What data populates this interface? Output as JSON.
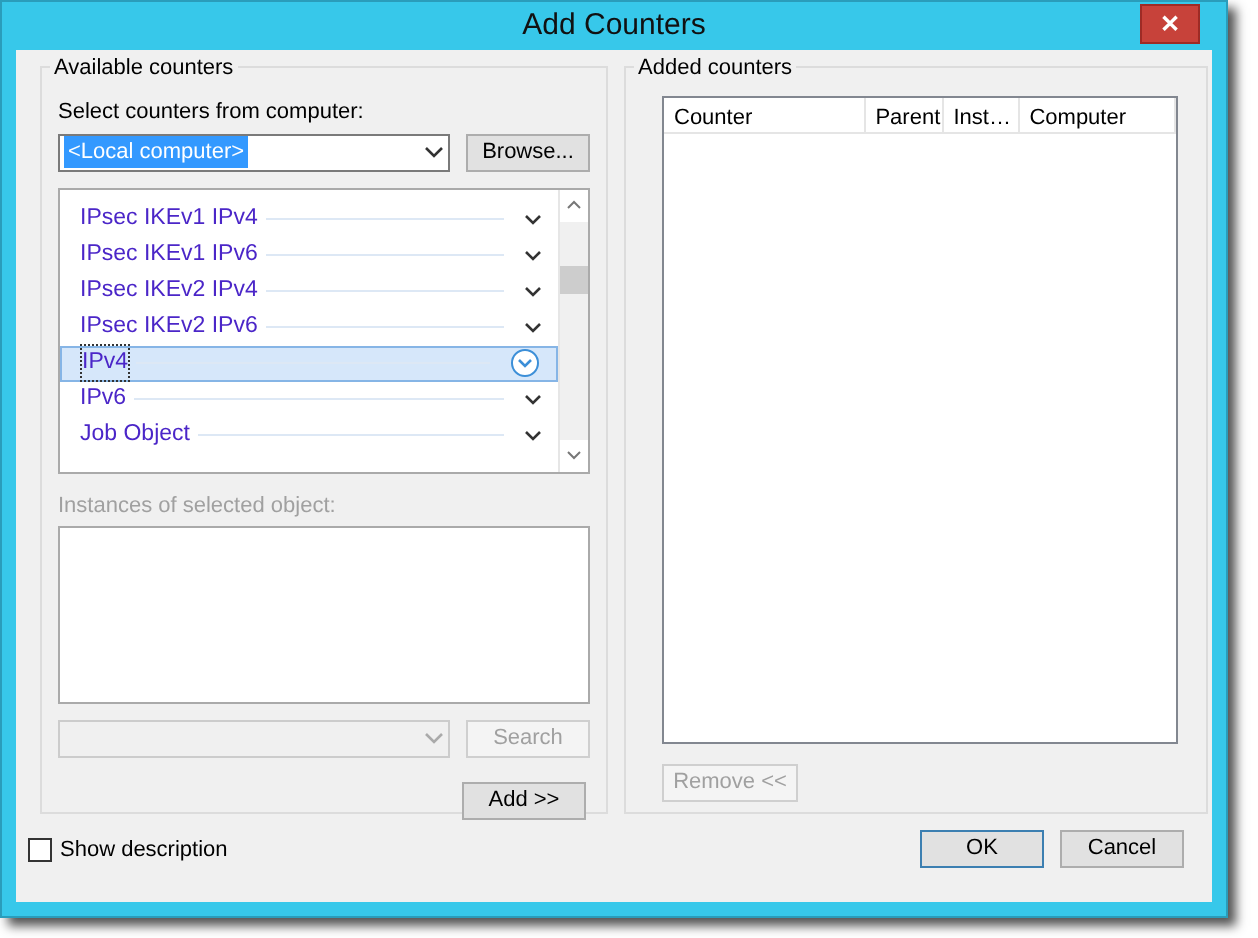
{
  "window": {
    "title": "Add Counters",
    "close": "✕"
  },
  "available_counters": {
    "label": "Available counters",
    "computer_label": "Select counters from computer:",
    "computer_value": "<Local computer>",
    "browse_button": "Browse...",
    "objects": [
      {
        "label": "IPsec IKEv1 IPv4",
        "selected": false
      },
      {
        "label": "IPsec IKEv1 IPv6",
        "selected": false
      },
      {
        "label": "IPsec IKEv2 IPv4",
        "selected": false
      },
      {
        "label": "IPsec IKEv2 IPv6",
        "selected": false
      },
      {
        "label": "IPv4",
        "selected": true
      },
      {
        "label": "IPv6",
        "selected": false
      },
      {
        "label": "Job Object",
        "selected": false
      }
    ],
    "instances_label": "Instances of selected object:",
    "instances_disabled": true,
    "search_button": "Search",
    "search_disabled": true,
    "add_button": "Add >>"
  },
  "added_counters": {
    "label": "Added counters",
    "columns": [
      "Counter",
      "Parent",
      "Inst…",
      "Computer"
    ],
    "remove_button": "Remove <<",
    "remove_disabled": true
  },
  "show_description": {
    "label": "Show description",
    "checked": false
  },
  "buttons": [
    {
      "label": "OK",
      "default": true
    },
    {
      "label": "Cancel",
      "default": false
    }
  ]
}
